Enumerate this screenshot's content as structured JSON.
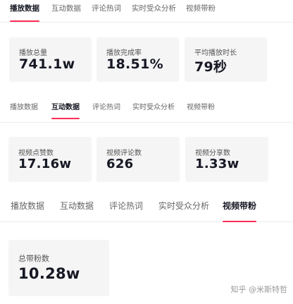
{
  "section1": {
    "tabs": [
      "播放数据",
      "互动数据",
      "评论热词",
      "实时受众分析",
      "视频带粉"
    ],
    "active_tab": "播放数据",
    "cards": [
      {
        "label": "播放总量",
        "value": "741.1w"
      },
      {
        "label": "播放完成率",
        "value": "18.51%"
      },
      {
        "label": "平均播放时长",
        "value": "79秒"
      }
    ]
  },
  "section2": {
    "tabs": [
      "播放数据",
      "互动数据",
      "评论热词",
      "实时受众分析",
      "视频带粉"
    ],
    "active_tab": "互动数据",
    "cards": [
      {
        "label": "视频点赞数",
        "value": "17.16w"
      },
      {
        "label": "视频评论数",
        "value": "626"
      },
      {
        "label": "视频分享数",
        "value": "1.33w"
      }
    ]
  },
  "section3": {
    "tabs": [
      "播放数据",
      "互动数据",
      "评论热词",
      "实时受众分析",
      "视频带粉"
    ],
    "active_tab": "视频带粉",
    "cards": [
      {
        "label": "总带粉数",
        "value": "10.28w"
      }
    ]
  },
  "watermark": "知乎 @米斯特哲",
  "colors": {
    "accent": "#fe2c55",
    "card_bg": "#f5f5f6",
    "text_primary": "#161823",
    "text_secondary": "#666666"
  }
}
